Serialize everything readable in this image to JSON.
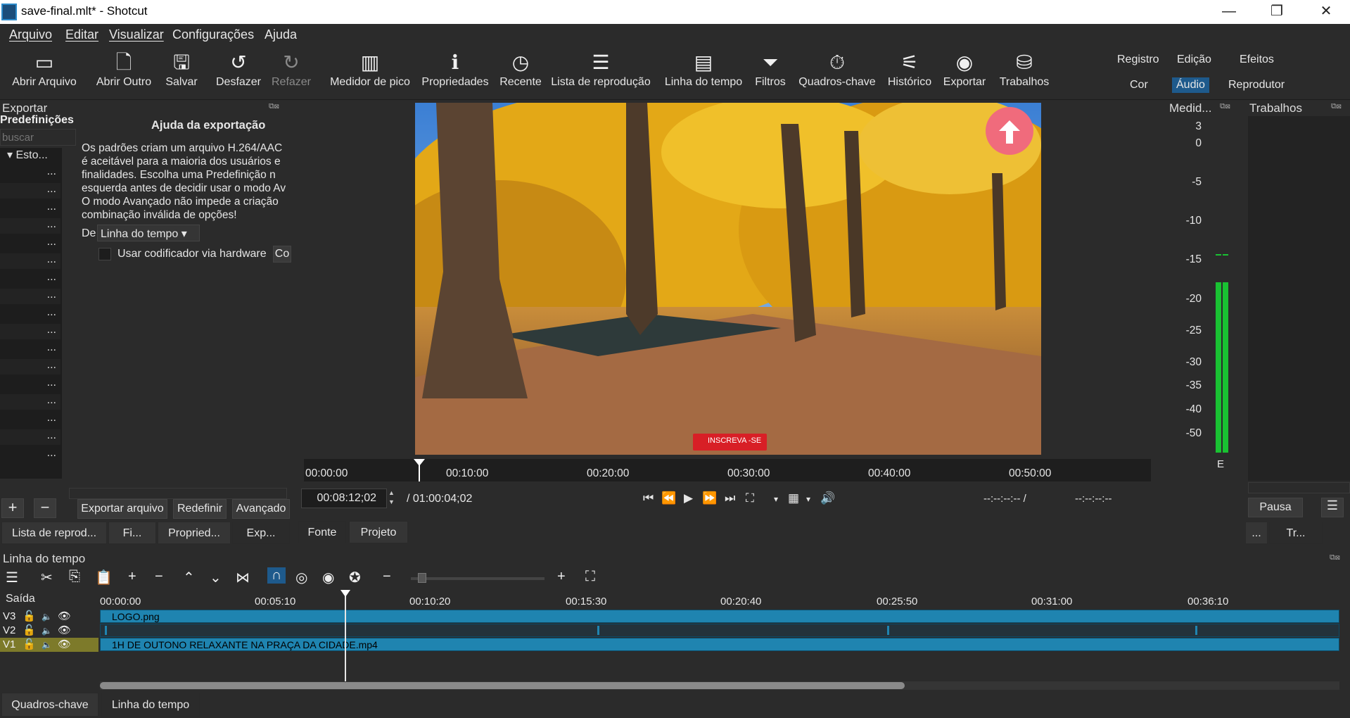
{
  "window": {
    "title": "save-final.mlt* - Shotcut",
    "minimize": "—",
    "maximize": "❐",
    "close": "✕"
  },
  "menu": [
    "Arquivo",
    "Editar",
    "Visualizar",
    "Configurações",
    "Ajuda"
  ],
  "toolbar": {
    "open_file": "Abrir Arquivo",
    "open_other": "Abrir  Outro",
    "save": "Salvar",
    "undo": "Desfazer",
    "redo": "Refazer",
    "peak_meter": "Medidor de pico",
    "properties": "Propriedades",
    "recent": "Recente",
    "playlist": "Lista de reprodução",
    "timeline": "Linha do tempo",
    "filters": "Filtros",
    "keyframes": "Quadros-chave",
    "history": "Histórico",
    "export": "Exportar",
    "jobs": "Trabalhos"
  },
  "layouts": {
    "registro": "Registro",
    "edicao": "Edição",
    "efeitos": "Efeitos",
    "cor": "Cor",
    "audio": "Áudio",
    "reprodutor": "Reprodutor"
  },
  "export_panel": {
    "title": "Exportar",
    "presets_label": "Predefinições",
    "search_placeholder": "buscar",
    "tree_root": "Esto...",
    "tree_item": "...",
    "help_title": "Ajuda da exportação",
    "help_lines": [
      "Os padrões criam um arquivo H.264/AAC",
      "é aceitável para a maioria dos usuários e",
      "finalidades. Escolha uma Predefinição n",
      "esquerda antes de decidir usar o modo Av",
      "O modo Avançado não impede a criação",
      "combinação inválida de opções!"
    ],
    "from_label": "De",
    "from_value": "Linha do tempo",
    "hw_encoder_label": "Usar codificador via hardware",
    "hw_config_btn": "Co",
    "export_btn": "Exportar arquivo",
    "reset_btn": "Redefinir",
    "advanced_btn": "Avançado"
  },
  "left_tabs": [
    "Lista de reprod...",
    "Fi...",
    "Propried...",
    "Exp..."
  ],
  "player": {
    "ruler_labels": [
      "00:00:00",
      "00:10:00",
      "00:20:00",
      "00:30:00",
      "00:40:00",
      "00:50:00"
    ],
    "timecode": "00:08:12;02",
    "duration": "/ 01:00:04;02",
    "in_point": "--:--:--:-- /",
    "out_point": "--:--:--:--",
    "subscribe_text": "INSCREVA -SE",
    "tab_source": "Fonte",
    "tab_project": "Projeto"
  },
  "meter": {
    "title": "Medid...",
    "labels": [
      "3",
      "0",
      "-5",
      "-10",
      "-15",
      "-20",
      "-25",
      "-30",
      "-35",
      "-40",
      "-50"
    ],
    "channel_label": "E"
  },
  "jobs_panel": {
    "title": "Trabalhos",
    "pause_btn": "Pausa",
    "tab1": "...",
    "tab2": "Tr..."
  },
  "timeline": {
    "title": "Linha do tempo",
    "output_label": "Saída",
    "ruler_labels": [
      "00:00:00",
      "00:05:10",
      "00:10:20",
      "00:15:30",
      "00:20:40",
      "00:25:50",
      "00:31:00",
      "00:36:10"
    ],
    "tracks": [
      {
        "name": "V3",
        "clip": "LOGO.png"
      },
      {
        "name": "V2",
        "clip": ""
      },
      {
        "name": "V1",
        "clip": "1H DE OUTONO RELAXANTE NA PRAÇA DA CIDADE.mp4"
      }
    ]
  },
  "bottom_tabs": [
    "Quadros-chave",
    "Linha do tempo"
  ],
  "colors": {
    "accent": "#1e5a8c",
    "clip": "#1f84b0",
    "meter": "#19c232"
  }
}
